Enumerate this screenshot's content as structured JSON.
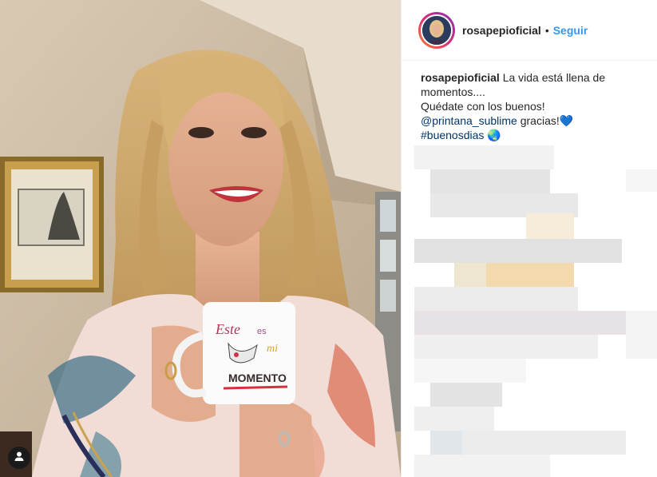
{
  "post": {
    "username": "rosapepioficial",
    "separator": "•",
    "follow_label": "Seguir",
    "caption": {
      "username": "rosapepioficial",
      "line1": "La vida está llena de momentos....",
      "line2": "Quédate con los buenos!",
      "mention": "@printana_sublime",
      "line3_rest": " gracias!💙",
      "hashtag": "#buenosdias",
      "globe": " 🌏"
    }
  },
  "mug": {
    "line1": "Este",
    "line2": "es",
    "line3": "mi",
    "line4": "MOMENTO"
  },
  "icons": {
    "user_tag": "person-icon"
  },
  "colors": {
    "follow": "#3897f0",
    "text": "#262626",
    "mention": "#003569"
  }
}
